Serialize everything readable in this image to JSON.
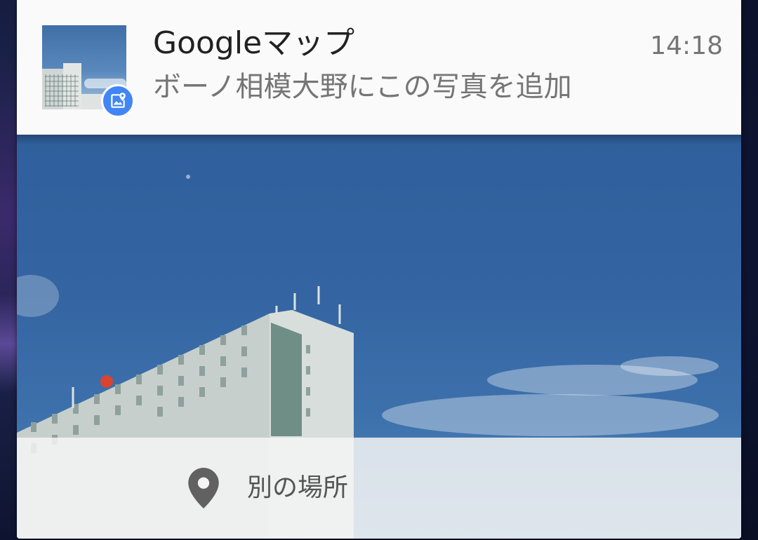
{
  "notification": {
    "app_name": "Googleマップ",
    "time": "14:18",
    "message": "ボーノ相模大野にこの写真を追加",
    "app_icon": "maps-add-photo-icon",
    "accent_color": "#4285f4"
  },
  "action": {
    "label": "別の場所",
    "icon": "map-pin-icon"
  }
}
